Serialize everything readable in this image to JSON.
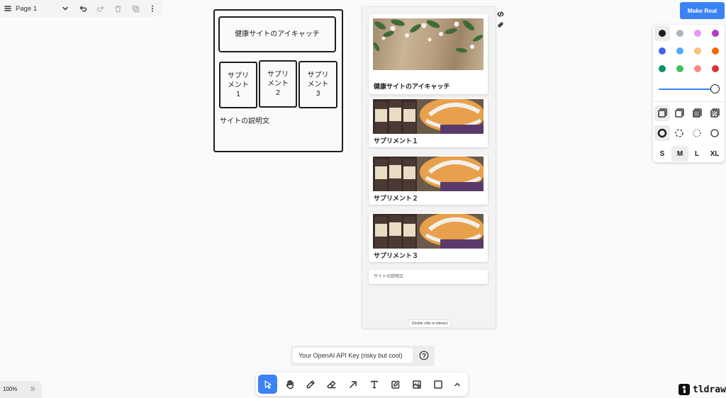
{
  "page_menu": {
    "page_name": "Page 1"
  },
  "sketch": {
    "header": "健康サイトのアイキャッチ",
    "boxes": [
      "サプリ\nメント\n1",
      "サプリ\nメント\n2",
      "サプリ\nメント\n3"
    ],
    "description": "サイトの説明文"
  },
  "preview": {
    "hero_title": "健康サイトのアイキャッチ",
    "supplements": [
      "サプリメント１",
      "サプリメント２",
      "サプリメント３"
    ],
    "description": "サイトの説明文",
    "hint": "Double click to interact"
  },
  "make_real": {
    "label": "Make Real"
  },
  "style_panel": {
    "colors": [
      "#1d1d1d",
      "#adb5bd",
      "#e599f7",
      "#ae3ec9",
      "#4263eb",
      "#4dabf7",
      "#ffc078",
      "#f76707",
      "#099268",
      "#40c057",
      "#ff8787",
      "#e03131"
    ],
    "selected_color": "#1d1d1d",
    "opacity_percent": 100,
    "sizes": [
      "S",
      "M",
      "L",
      "XL"
    ],
    "selected_size": "M"
  },
  "api_key": {
    "placeholder": "Your OpenAI API Key (risky but cool)",
    "value": ""
  },
  "toolbar": {
    "tools": [
      "select-icon",
      "hand-icon",
      "pencil-icon",
      "eraser-icon",
      "arrow-icon",
      "text-icon",
      "note-icon",
      "image-icon",
      "rectangle-icon",
      "chevron-up-icon"
    ],
    "active_tool": "select-icon"
  },
  "zoom": {
    "level": "100%"
  },
  "brand": {
    "name": "tldraw"
  }
}
